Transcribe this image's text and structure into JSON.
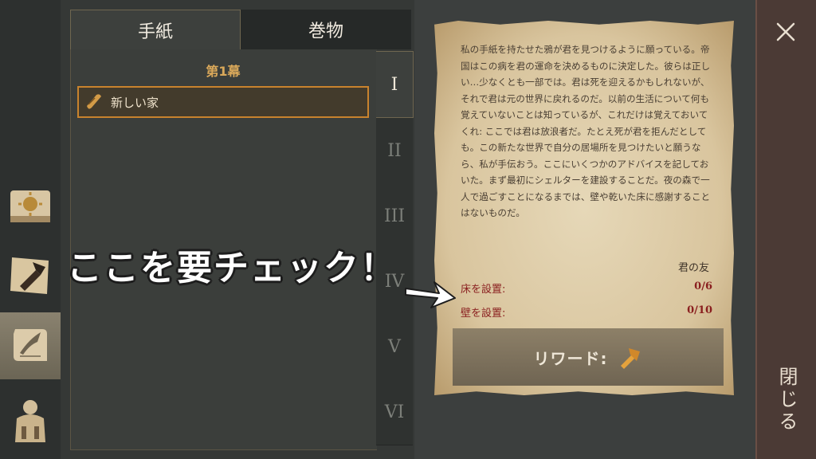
{
  "tabs": {
    "letters": "手紙",
    "scrolls": "巻物"
  },
  "act_title": "第1幕",
  "quest": {
    "label": "新しい家",
    "icon": "scroll-icon"
  },
  "chapters": [
    "I",
    "II",
    "III",
    "IV",
    "V",
    "VI"
  ],
  "letter": {
    "body": "私の手紙を持たせた鴉が君を見つけるように願っている。帝国はこの病を君の運命を決めるものに決定した。彼らは正しい…少なくとも一部では。君は死を迎えるかもしれないが、それで君は元の世界に戻れるのだ。以前の生活について何も覚えていないことは知っているが、これだけは覚えておいてくれ: ここでは君は放浪者だ。たとえ死が君を拒んだとしても。この新たな世界で自分の居場所を見つけたいと願うなら、私が手伝おう。ここにいくつかのアドバイスを記しておいた。まず最初にシェルターを建設することだ。夜の森で一人で過ごすことになるまでは、壁や乾いた床に感謝することはないものだ。",
    "signature": "君の友"
  },
  "tasks": [
    {
      "label": "床を設置:",
      "value": "0/6"
    },
    {
      "label": "壁を設置:",
      "value": "0/10"
    }
  ],
  "reward": {
    "label": "リワード:",
    "icon": "hammer-icon"
  },
  "close": {
    "label": "閉じる"
  },
  "annotation": "ここを要チェック！",
  "nav": [
    "recipes-book-icon",
    "crafting-map-icon",
    "quest-scroll-icon",
    "backpack-icon"
  ],
  "colors": {
    "accent": "#c9832d",
    "task_red": "#8a1f1f",
    "parchment": "#e2d2b0"
  }
}
